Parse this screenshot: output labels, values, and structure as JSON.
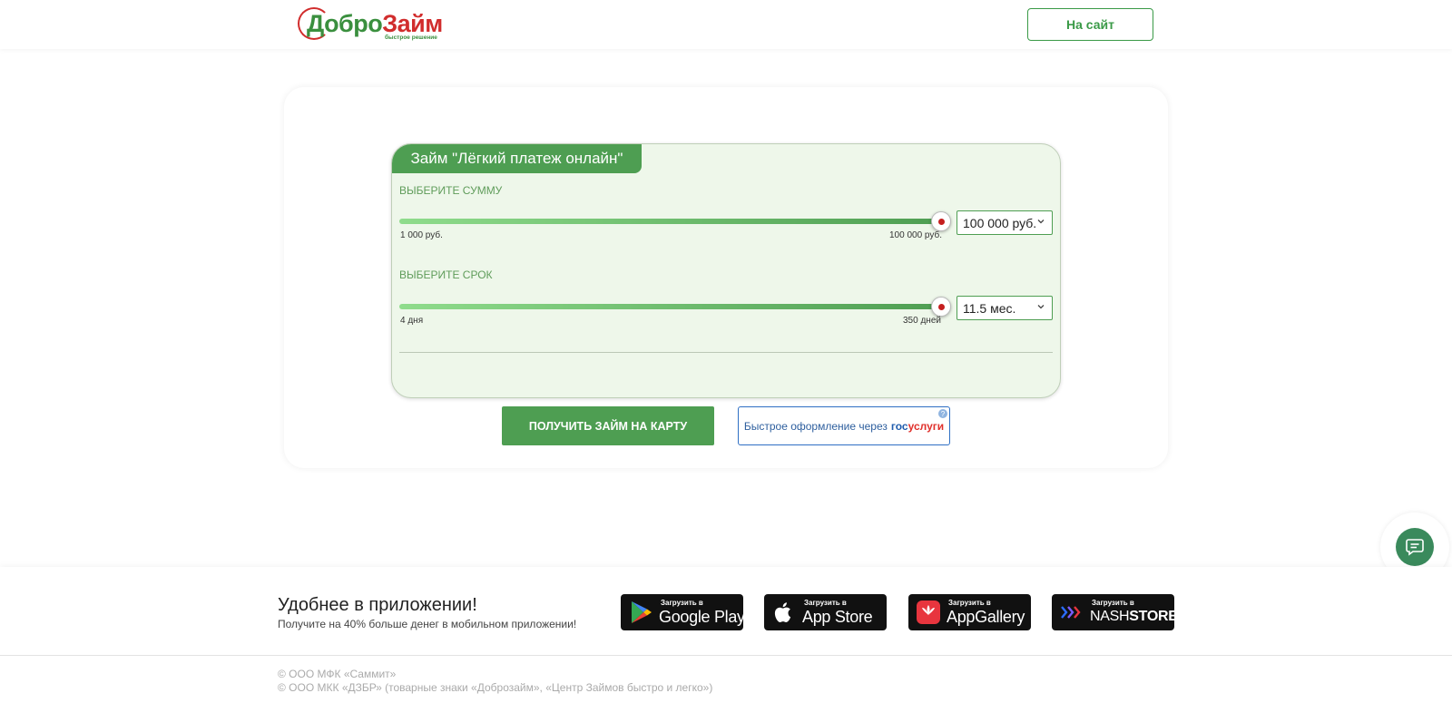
{
  "header": {
    "logo_text_green": "Добро",
    "logo_text_red": "Займ",
    "logo_sub": "быстрое решение",
    "site_button": "На сайт"
  },
  "calculator": {
    "title": "Займ \"Лёгкий платеж онлайн\"",
    "amount": {
      "label": "Выберите сумму",
      "min_label": "1 000 руб.",
      "max_label": "100 000 руб.",
      "selected": "100 000 руб.",
      "slider_fraction": 1.0
    },
    "term": {
      "label": "Выберите срок",
      "min_label": "4 дня",
      "max_label": "350 дней",
      "selected": "11.5 мес.",
      "slider_fraction": 1.0
    }
  },
  "actions": {
    "get_loan": "ПОЛУЧИТЬ ЗАЙМ НА КАРТУ",
    "gos_prefix": "Быстрое оформление через",
    "gos_blue": "гос",
    "gos_red": "услуги",
    "help": "?"
  },
  "app_band": {
    "title": "Удобнее в приложении!",
    "subtitle": "Получите на 40% больше денег в мобильном приложении!",
    "stores": [
      {
        "small": "Загрузить в",
        "big": "Google Play",
        "icon": "google-play-icon"
      },
      {
        "small": "Загрузить в",
        "big": "App Store",
        "icon": "apple-icon"
      },
      {
        "small": "Загрузить в",
        "big": "AppGallery",
        "icon": "huawei-icon"
      },
      {
        "small": "Загрузить в",
        "big_light": "NASH",
        "big_bold": "STORE",
        "icon": "nashstore-icon"
      }
    ]
  },
  "footer": {
    "line1": "© ООО МФК «Саммит»",
    "line2": "© ООО МКК «ДЗБР» (товарные знаки «Доброзайм», «Центр Займов быстро и легко»)"
  },
  "colors": {
    "brand_green": "#4e9e52",
    "brand_red": "#d12d2d",
    "calc_bg": "#eef7ea"
  }
}
